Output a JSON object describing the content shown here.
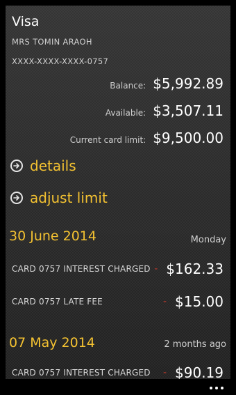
{
  "card": {
    "title": "Visa",
    "holder": "MRS TOMIN ARAOH",
    "number": "XXXX-XXXX-XXXX-0757"
  },
  "stats": {
    "balance_label": "Balance:",
    "balance_value": "$5,992.89",
    "available_label": "Available:",
    "available_value": "$3,507.11",
    "limit_label": "Current card limit:",
    "limit_value": "$9,500.00"
  },
  "actions": {
    "details_label": "details",
    "adjust_label": "adjust limit",
    "icon": "arrow-right-circle-icon"
  },
  "groups": [
    {
      "date": "30 June 2014",
      "sub": "Monday",
      "transactions": [
        {
          "desc": "CARD 0757 INTEREST CHARGED",
          "sign": "-",
          "amount": "$162.33"
        },
        {
          "desc": "CARD 0757 LATE FEE",
          "sign": "-",
          "amount": "$15.00"
        }
      ]
    },
    {
      "date": "07 May 2014",
      "sub": "2 months ago",
      "transactions": [
        {
          "desc": "CARD 0757 INTEREST CHARGED",
          "sign": "-",
          "amount": "$90.19"
        }
      ]
    }
  ],
  "colors": {
    "accent": "#f4c231",
    "negative": "#c0392b"
  },
  "appbar": {
    "more_icon": "ellipsis-icon"
  }
}
